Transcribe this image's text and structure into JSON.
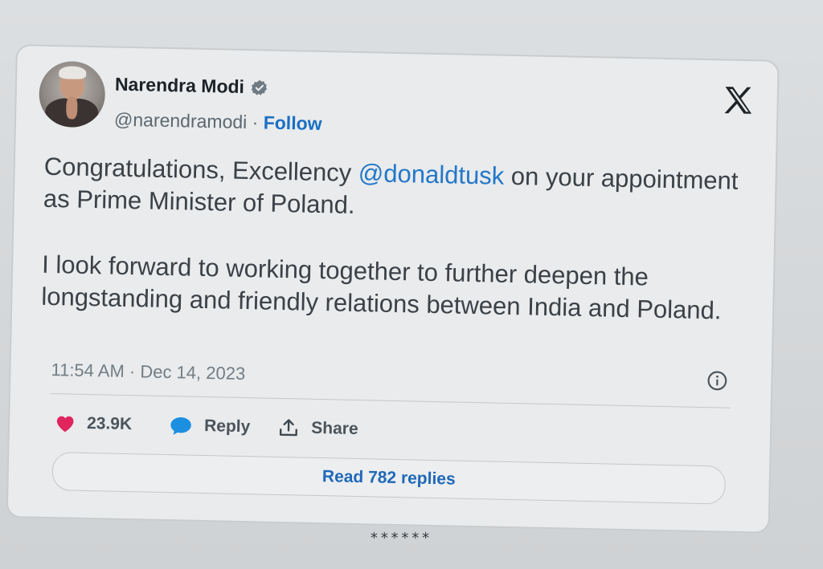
{
  "tweet": {
    "author_name": "Narendra Modi",
    "handle": "@narendramodi",
    "separator": " · ",
    "follow_label": "Follow",
    "verified_icon": "verified-badge-icon",
    "platform_logo": "x-logo-icon",
    "text_part1": "Congratulations, Excellency ",
    "mention": "@donaldtusk",
    "text_part2": " on your appointment as Prime Minister of Poland.",
    "paragraph2": "I look forward to working together to further deepen the longstanding and friendly relations between India and Poland.",
    "timestamp": "11:54 AM · Dec 14, 2023",
    "likes_count": "23.9K",
    "reply_label": "Reply",
    "share_label": "Share",
    "read_replies_label": "Read 782 replies"
  },
  "footer": {
    "stars": "******"
  },
  "colors": {
    "link": "#2377c9",
    "like": "#e0245e",
    "reply": "#1d9bf0"
  }
}
